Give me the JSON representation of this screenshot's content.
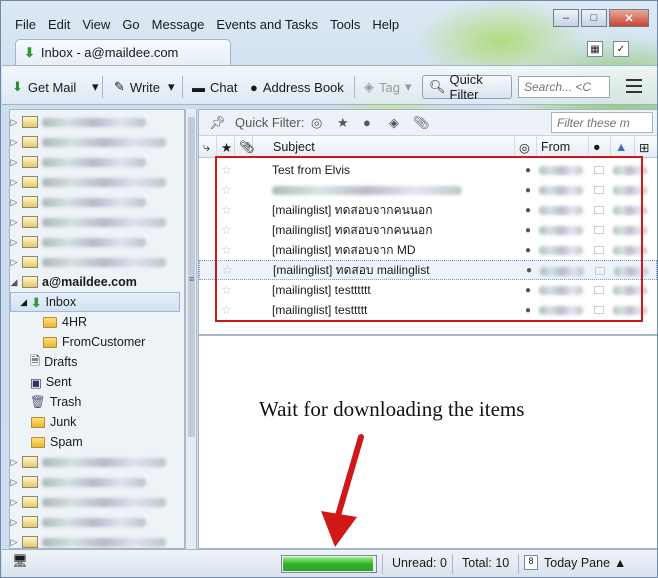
{
  "menu": [
    "File",
    "Edit",
    "View",
    "Go",
    "Message",
    "Events and Tasks",
    "Tools",
    "Help"
  ],
  "menu_ul": [
    "F",
    "E",
    "V",
    "G",
    "M",
    "T",
    "T",
    "H"
  ],
  "tab": {
    "title": "Inbox - a@maildee.com"
  },
  "window": {
    "min": "–",
    "max": "□",
    "close": "✕"
  },
  "toolbar": {
    "get_mail": "Get Mail",
    "write": "Write",
    "chat": "Chat",
    "address_book": "Address Book",
    "tag": "Tag",
    "quick_filter": "Quick Filter",
    "search_placeholder": "Search... <C"
  },
  "folders": {
    "account": "a@maildee.com",
    "items": [
      {
        "name": "Inbox",
        "icon": "inbox-icon",
        "level": 1,
        "selected": true
      },
      {
        "name": "4HR",
        "icon": "folder-icon",
        "level": 2
      },
      {
        "name": "FromCustomer",
        "icon": "folder-icon",
        "level": 2
      },
      {
        "name": "Drafts",
        "icon": "drafts-icon",
        "level": 1
      },
      {
        "name": "Sent",
        "icon": "sent-icon",
        "level": 1
      },
      {
        "name": "Trash",
        "icon": "trash-icon",
        "level": 1
      },
      {
        "name": "Junk",
        "icon": "folder-icon",
        "level": 1
      },
      {
        "name": "Spam",
        "icon": "folder-icon",
        "level": 1
      }
    ]
  },
  "quick_filter_bar": {
    "label": "Quick Filter:",
    "filter_placeholder": "Filter these m"
  },
  "columns": {
    "subject": "Subject",
    "from": "From"
  },
  "messages": [
    {
      "subject": "Test from Elvis"
    },
    {
      "subject": ""
    },
    {
      "subject": "[mailinglist] ทดสอบจากคนนอก"
    },
    {
      "subject": "[mailinglist] ทดสอบจากคนนอก"
    },
    {
      "subject": "[mailinglist] ทดสอบจาก MD"
    },
    {
      "subject": "[mailinglist] ทดสอบ mailinglist",
      "selected": true
    },
    {
      "subject": "[mailinglist] testttttt"
    },
    {
      "subject": "[mailinglist] testtttt"
    }
  ],
  "annotation": "Wait for downloading the items",
  "status": {
    "unread": "Unread: 0",
    "total": "Total: 10",
    "today_pane": "Today Pane",
    "today_num": "8",
    "progress": 0.98
  },
  "colors": {
    "accent_red": "#d01818",
    "progress_green": "#34b42a"
  }
}
